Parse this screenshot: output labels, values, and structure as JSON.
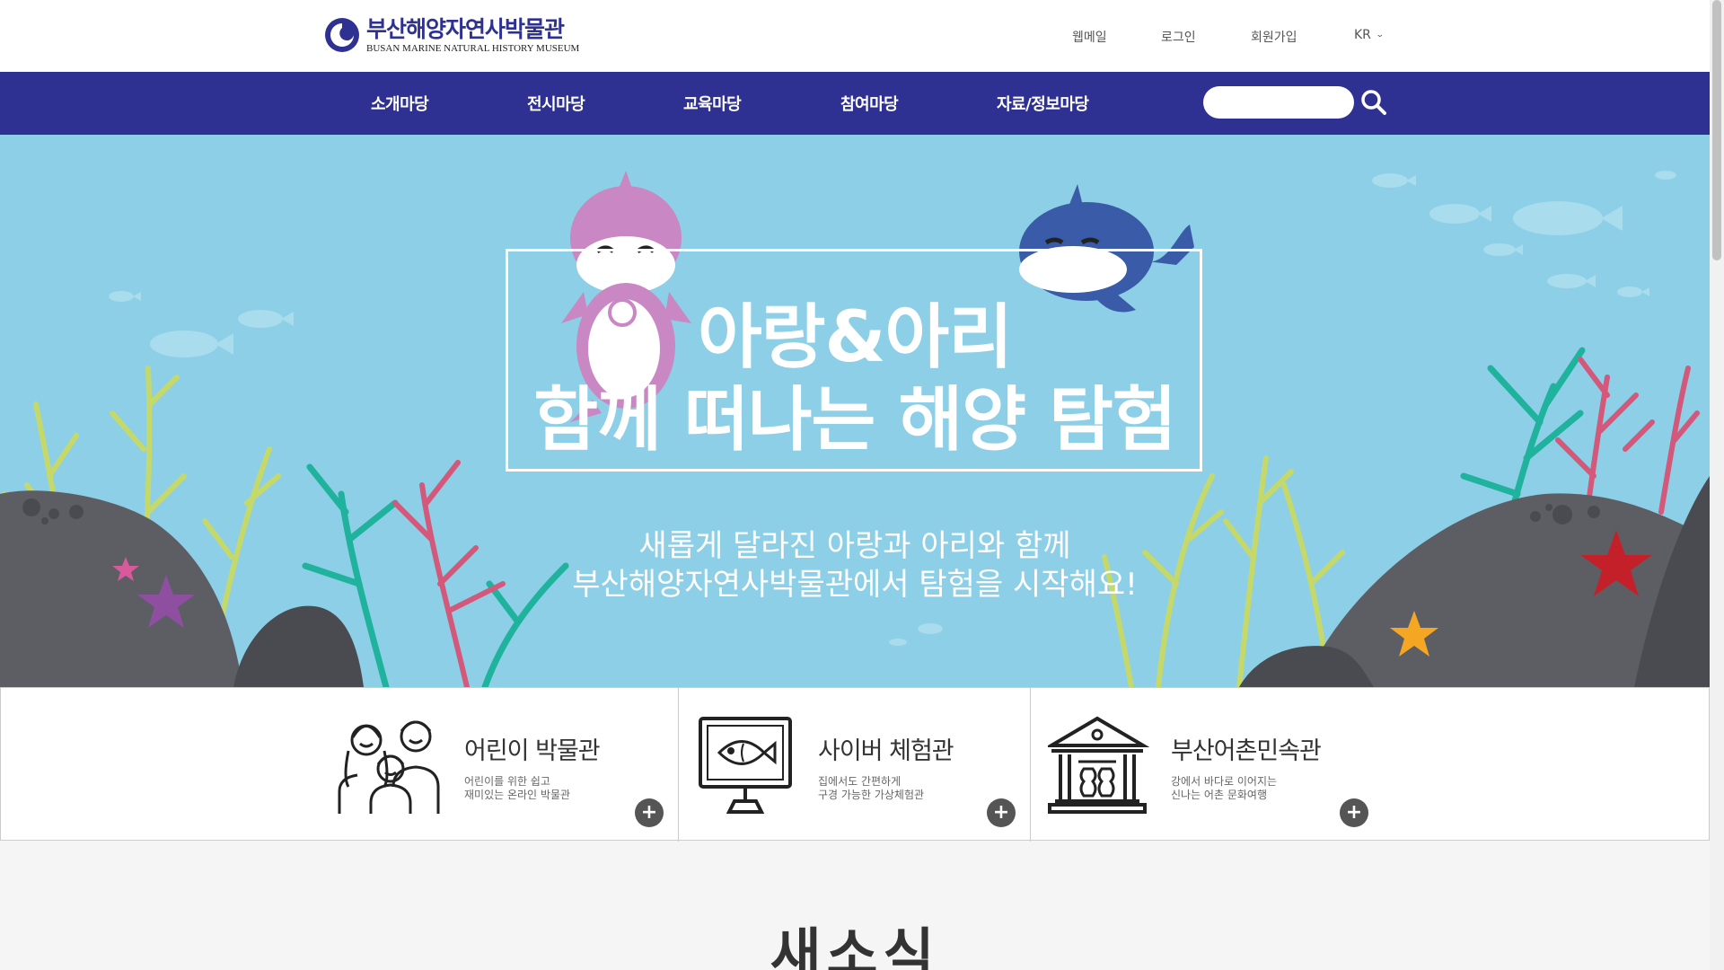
{
  "header": {
    "logo_ko": "부산해양자연사박물관",
    "logo_en": "BUSAN MARINE NATURAL HISTORY MUSEUM",
    "util": [
      "웹메일",
      "로그인",
      "회원가입"
    ],
    "lang": "KR"
  },
  "nav": {
    "items": [
      "소개마당",
      "전시마당",
      "교육마당",
      "참여마당",
      "자료/정보마당"
    ],
    "search_placeholder": ""
  },
  "hero": {
    "title_line1": "아랑&아리",
    "title_line2": "함께 떠나는 해양 탐험",
    "sub_line1": "새롭게 달라진 아랑과 아리와 함께",
    "sub_line2": "부산해양자연사박물관에서 탐험을 시작해요!"
  },
  "quick": [
    {
      "title": "어린이 박물관",
      "desc1": "어린이를 위한 쉽고",
      "desc2": "재미있는 온라인 박물관",
      "icon": "family-icon"
    },
    {
      "title": "사이버 체험관",
      "desc1": "집에서도 간편하게",
      "desc2": "구경 가능한 가상체험관",
      "icon": "monitor-fish-icon"
    },
    {
      "title": "부산어촌민속관",
      "desc1": "강에서 바다로 이어지는",
      "desc2": "신나는 어촌 문화여행",
      "icon": "museum-building-icon"
    }
  ],
  "news": {
    "title": "새소식"
  },
  "colors": {
    "brand": "#2e3192",
    "hero_bg": "#8ccfe6",
    "plus_btn": "#555555"
  }
}
